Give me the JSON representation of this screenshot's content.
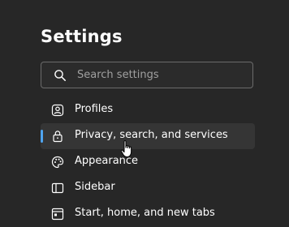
{
  "page": {
    "title": "Settings"
  },
  "search": {
    "placeholder": "Search settings",
    "icon": "search-icon"
  },
  "nav": {
    "items": [
      {
        "label": "Profiles",
        "icon": "profile-icon",
        "active": false
      },
      {
        "label": "Privacy, search, and services",
        "icon": "lock-icon",
        "active": true
      },
      {
        "label": "Appearance",
        "icon": "palette-icon",
        "active": false
      },
      {
        "label": "Sidebar",
        "icon": "sidebar-icon",
        "active": false
      },
      {
        "label": "Start, home, and new tabs",
        "icon": "home-tabs-icon",
        "active": false
      }
    ]
  },
  "colors": {
    "background": "#272727",
    "accent": "#4fa4ef",
    "active_background": "#353535",
    "search_border": "#6b6b6b"
  }
}
